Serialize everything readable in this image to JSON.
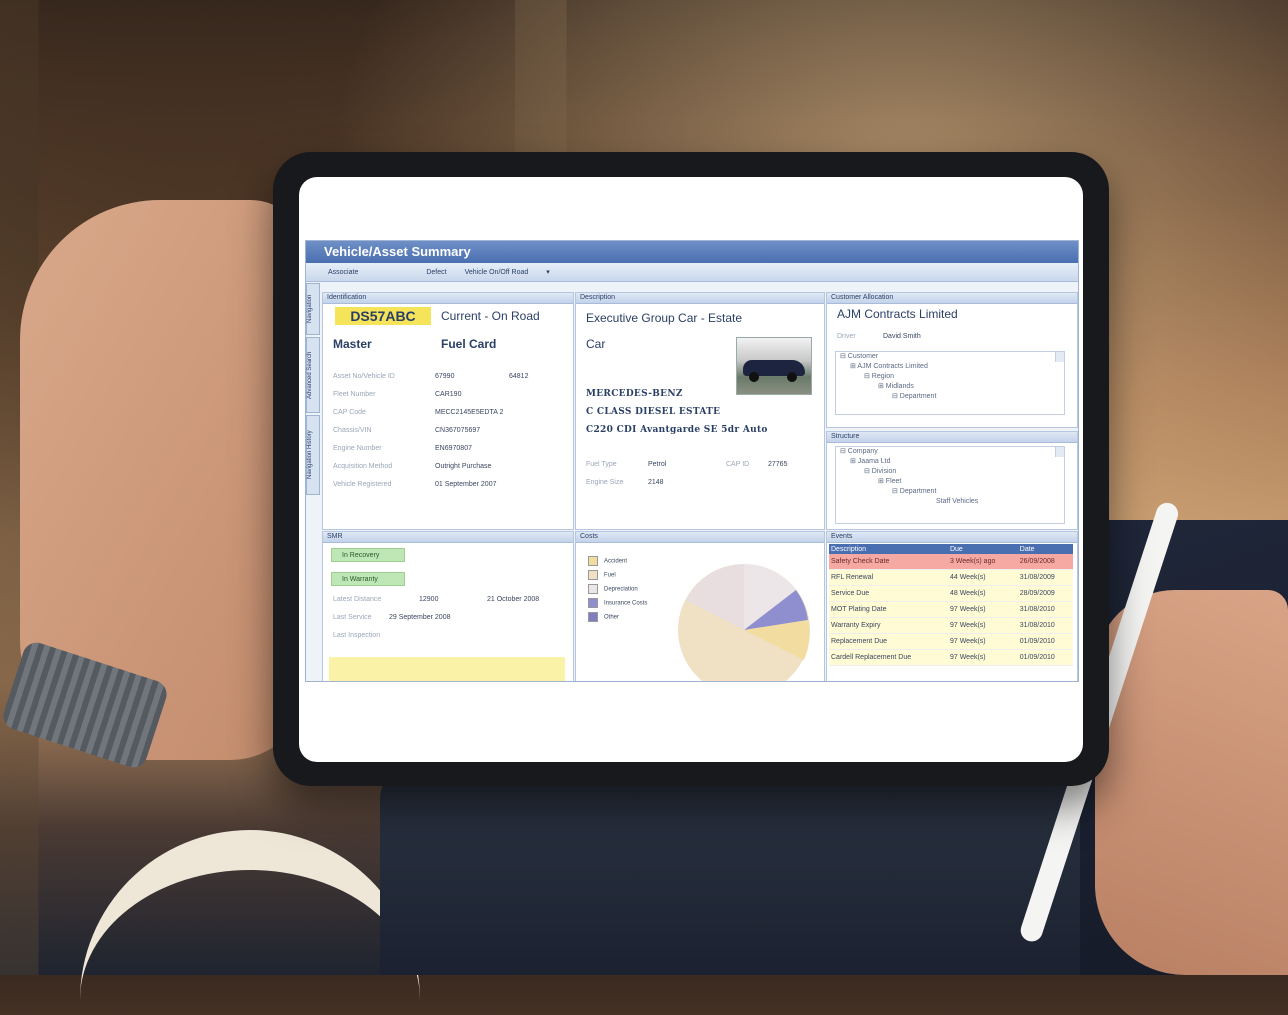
{
  "window": {
    "title": "Vehicle/Asset Summary"
  },
  "toolbar": {
    "items": [
      "Associate",
      "Defect",
      "Vehicle On/Off Road",
      "▾"
    ]
  },
  "sidetabs": [
    "Navigation",
    "Advanced Search",
    "Navigation History"
  ],
  "identification": {
    "header": "Identification",
    "registration": "DS57ABC",
    "status": "Current - On Road",
    "type": "Master",
    "card": "Fuel Card",
    "fields": [
      {
        "label": "Asset No/Vehicle ID",
        "value": "67990",
        "extra": "64812"
      },
      {
        "label": "Fleet Number",
        "value": "CAR190",
        "extra": ""
      },
      {
        "label": "CAP Code",
        "value": "MECC2145E5EDTA 2",
        "extra": ""
      },
      {
        "label": "Chassis/VIN",
        "value": "CN367075697",
        "extra": ""
      },
      {
        "label": "Engine Number",
        "value": "EN6970807",
        "extra": ""
      },
      {
        "label": "Acquisition Method",
        "value": "Outright Purchase",
        "extra": ""
      },
      {
        "label": "Vehicle Registered",
        "value": "01 September 2007",
        "extra": ""
      }
    ]
  },
  "description": {
    "header": "Description",
    "title_line1": "Executive Group Car - Estate",
    "title_line2": "Car",
    "make": "MERCEDES-BENZ",
    "model": "C CLASS DIESEL ESTATE",
    "variant": "C220 CDI Avantgarde SE 5dr Auto",
    "fuel_type_label": "Fuel Type",
    "fuel_type": "Petrol",
    "cap_id_label": "CAP ID",
    "cap_id": "27765",
    "engine_size_label": "Engine Size",
    "engine_size": "2148"
  },
  "customer": {
    "header": "Customer Allocation",
    "company": "AJM Contracts Limited",
    "driver_label": "Driver",
    "driver": "David Smith",
    "tree": [
      "⊟ Customer",
      "⊞ AJM Contracts Limited",
      "⊟ Region",
      "⊞ Midlands",
      "⊟ Department"
    ]
  },
  "structure": {
    "header": "Structure",
    "tree": [
      "⊟ Company",
      "⊞ Jaama Ltd",
      "⊟ Division",
      "⊞ Fleet",
      "⊟ Department",
      "Staff Vehicles"
    ]
  },
  "smr": {
    "header": "SMR",
    "badges": [
      "In Recovery",
      "In Warranty"
    ],
    "latest_distance_label": "Latest Distance",
    "latest_distance": "12900",
    "latest_distance_date": "21 October 2008",
    "last_service_label": "Last Service",
    "last_service": "29 September 2008",
    "last_inspection_label": "Last Inspection"
  },
  "costs": {
    "header": "Costs",
    "legend": [
      {
        "name": "Accident",
        "color": "#f2dca0"
      },
      {
        "name": "Fuel",
        "color": "#f0e0c4"
      },
      {
        "name": "Depreciation",
        "color": "#ece6e8"
      },
      {
        "name": "Insurance Costs",
        "color": "#8f8fd0"
      },
      {
        "name": "Other",
        "color": "#7f7fbf"
      }
    ]
  },
  "events": {
    "header": "Events",
    "columns": [
      "Description",
      "Due",
      "Date"
    ],
    "rows": [
      {
        "description": "Safety Check Date",
        "due": "3 Week(s) ago",
        "date": "26/09/2008",
        "alert": true
      },
      {
        "description": "RFL Renewal",
        "due": "44 Week(s)",
        "date": "31/08/2009",
        "alert": false
      },
      {
        "description": "Service Due",
        "due": "48 Week(s)",
        "date": "28/09/2009",
        "alert": false
      },
      {
        "description": "MOT Plating Date",
        "due": "97 Week(s)",
        "date": "31/08/2010",
        "alert": false
      },
      {
        "description": "Warranty Expiry",
        "due": "97 Week(s)",
        "date": "31/08/2010",
        "alert": false
      },
      {
        "description": "Replacement Due",
        "due": "97 Week(s)",
        "date": "01/09/2010",
        "alert": false
      },
      {
        "description": "Cardell Replacement Due",
        "due": "97 Week(s)",
        "date": "01/09/2010",
        "alert": false
      }
    ]
  }
}
